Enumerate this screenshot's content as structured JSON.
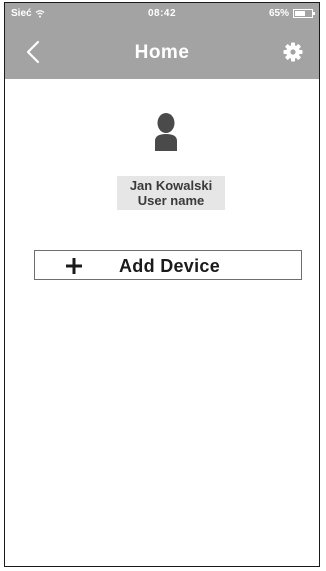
{
  "status_bar": {
    "carrier": "Sieć",
    "time": "08:42",
    "battery_percent_label": "65%",
    "battery_level": 0.65,
    "icons": [
      "wifi-icon",
      "battery-icon"
    ]
  },
  "nav": {
    "back_icon": "chevron-left-icon",
    "title": "Home",
    "settings_icon": "gear-icon"
  },
  "profile": {
    "avatar_icon": "person-icon",
    "name": "Jan Kowalski",
    "subtitle": "User name"
  },
  "actions": {
    "add_device_icon": "plus-icon",
    "add_device_label": "Add Device"
  },
  "colors": {
    "header": "#a3a3a3",
    "card": "#e6e6e6",
    "text_dark": "#1a1a1a"
  }
}
